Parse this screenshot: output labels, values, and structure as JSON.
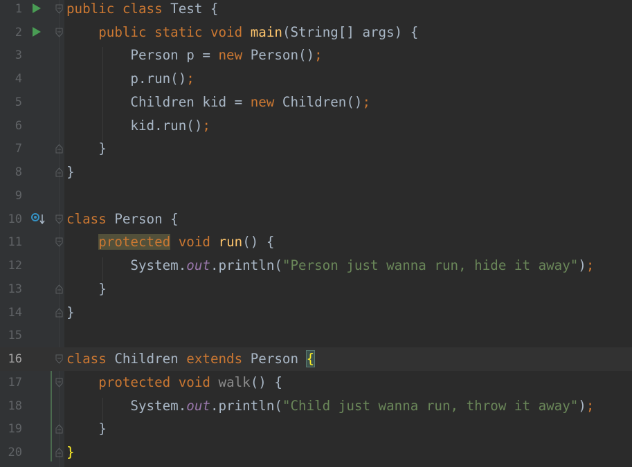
{
  "editor": {
    "language": "Java",
    "current_line": 16,
    "line_numbers": [
      "1",
      "2",
      "3",
      "4",
      "5",
      "6",
      "7",
      "8",
      "9",
      "10",
      "11",
      "12",
      "13",
      "14",
      "15",
      "16",
      "17",
      "18",
      "19",
      "20"
    ]
  },
  "gutter_icons": {
    "run_lines": [
      1,
      2
    ],
    "override_line": 10,
    "run_icon": "run-triangle-icon",
    "override_icon": "overridden-method-icon"
  },
  "colors": {
    "background": "#2b2b2b",
    "keyword": "#cc7832",
    "function": "#ffc66d",
    "field": "#9876aa",
    "string": "#6a8759",
    "text": "#a9b7c6"
  },
  "code": {
    "l1": {
      "kw1": "public class",
      "rest": " Test {"
    },
    "l2": {
      "kw1": "public static void",
      "fn": "main",
      "rest": "(String[] args) {"
    },
    "l3": {
      "a": "Person p = ",
      "kw": "new",
      "b": " Person()",
      "semi": ";"
    },
    "l4": {
      "a": "p.run()",
      "semi": ";"
    },
    "l5": {
      "a": "Children kid = ",
      "kw": "new",
      "b": " Children()",
      "semi": ";"
    },
    "l6": {
      "a": "kid.run()",
      "semi": ";"
    },
    "l7": {
      "a": "}"
    },
    "l8": {
      "a": "}"
    },
    "l10": {
      "kw": "class",
      "rest": " Person {"
    },
    "l11": {
      "kw1": "protected",
      "kw2": "void",
      "fn": "run",
      "rest": "() {"
    },
    "l12": {
      "a": "System.",
      "fld": "out",
      "b": ".println(",
      "str": "\"Person just wanna run, hide it away\"",
      "c": ")",
      "semi": ";"
    },
    "l13": {
      "a": "}"
    },
    "l14": {
      "a": "}"
    },
    "l16": {
      "kw1": "class",
      "a": " Children ",
      "kw2": "extends",
      "b": " Person ",
      "brace": "{"
    },
    "l17": {
      "kw1": "protected",
      "kw2": "void",
      "fn": "walk",
      "rest": "() {"
    },
    "l18": {
      "a": "System.",
      "fld": "out",
      "b": ".println(",
      "str": "\"Child just wanna run, throw it away\"",
      "c": ")",
      "semi": ";"
    },
    "l19": {
      "a": "}"
    },
    "l20": {
      "brace": "}"
    }
  }
}
